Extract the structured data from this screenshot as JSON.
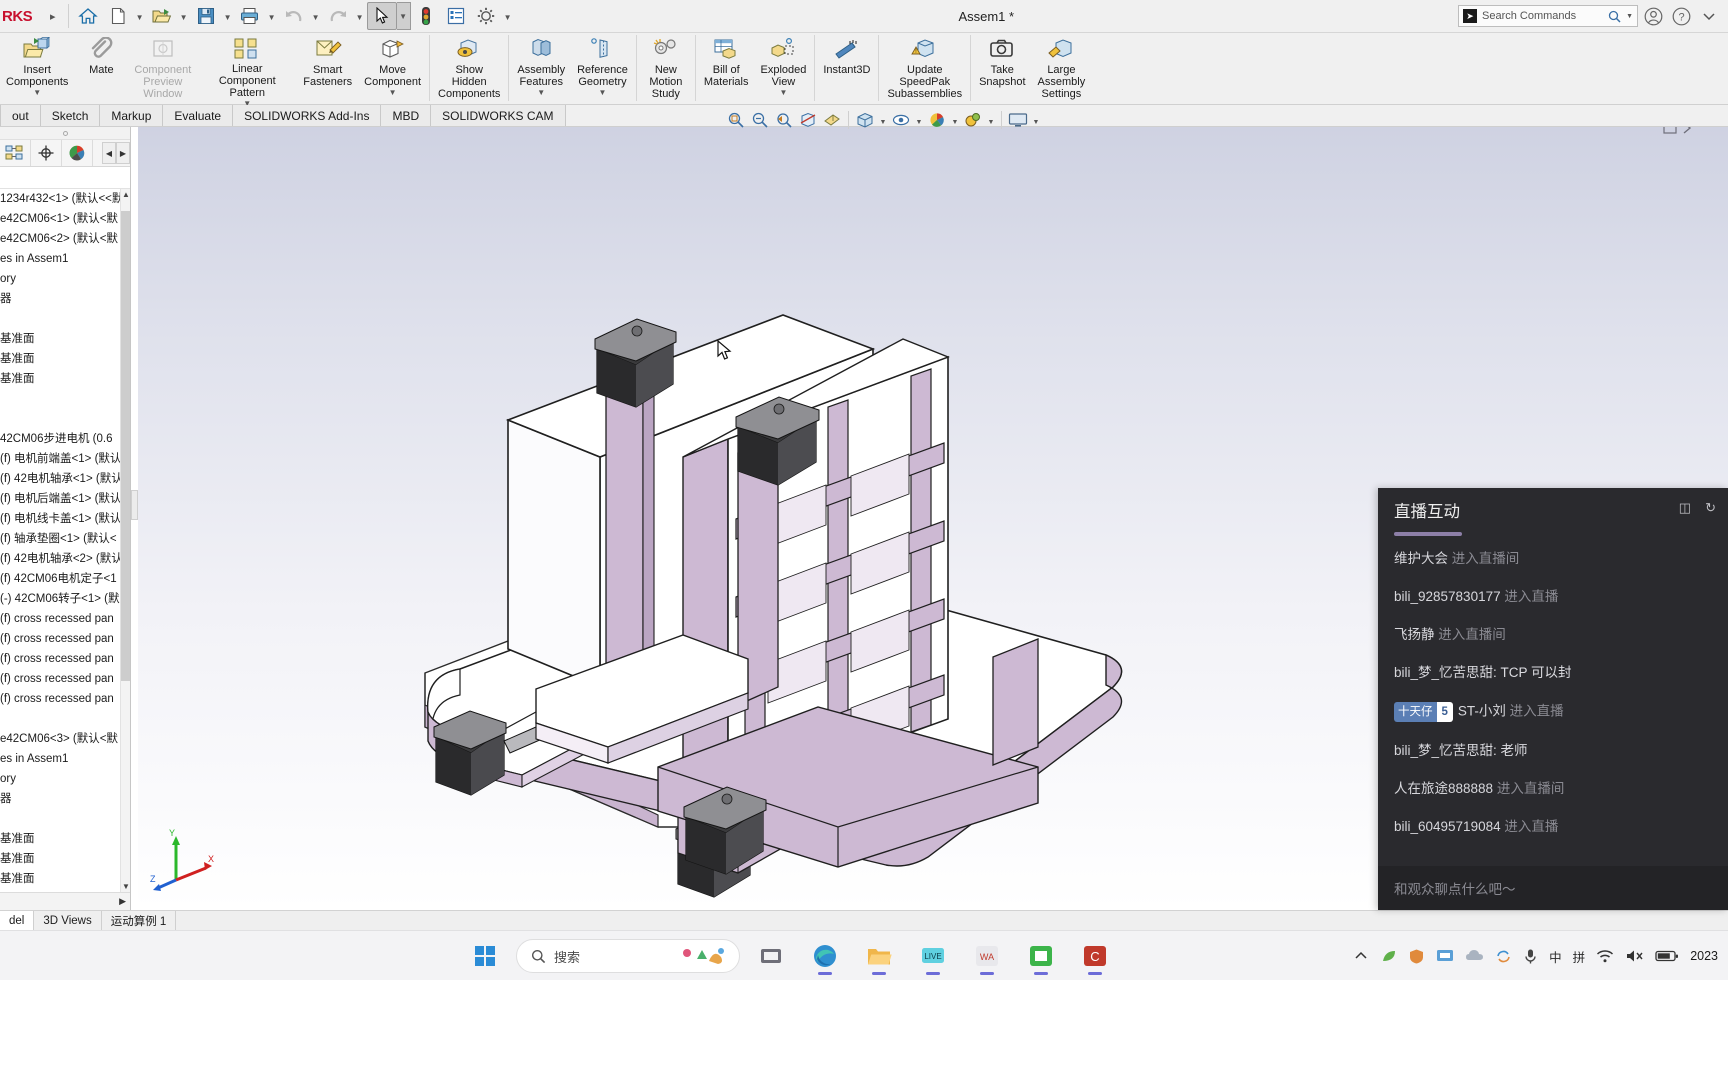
{
  "app": {
    "brand": "RKS",
    "document_title": "Assem1 *",
    "search_placeholder": "Search Commands"
  },
  "quick_access": [
    {
      "name": "home-button",
      "icon": "home-icon"
    },
    {
      "name": "new-document-button",
      "icon": "new-file-icon",
      "dropdown": true
    },
    {
      "name": "open-document-button",
      "icon": "open-folder-icon",
      "dropdown": true
    },
    {
      "name": "save-button",
      "icon": "save-disk-icon",
      "dropdown": true
    },
    {
      "name": "print-button",
      "icon": "printer-icon",
      "dropdown": true
    },
    {
      "name": "undo-button",
      "icon": "undo-arrow-icon",
      "dropdown": true
    },
    {
      "name": "redo-button",
      "icon": "redo-arrow-icon",
      "dropdown": true
    },
    {
      "name": "select-tool-button",
      "icon": "cursor-arrow-icon",
      "dropdown": true,
      "pressed": true
    },
    {
      "name": "rebuild-button",
      "icon": "traffic-light-icon"
    },
    {
      "name": "options-list-button",
      "icon": "list-properties-icon"
    },
    {
      "name": "settings-button",
      "icon": "gear-icon",
      "dropdown": true
    }
  ],
  "ribbon": {
    "items": [
      {
        "label": "Insert\nComponents",
        "lines": [
          "Insert",
          "Components"
        ],
        "icon": "insert-components-icon",
        "caret": true,
        "disabled": false
      },
      {
        "label": "Mate",
        "lines": [
          "Mate"
        ],
        "icon": "mate-paperclip-icon",
        "caret": false,
        "disabled": false
      },
      {
        "label": "Component Preview Window",
        "lines": [
          "Component",
          "Preview",
          "Window"
        ],
        "icon": "component-preview-icon",
        "caret": false,
        "disabled": true
      },
      {
        "label": "Linear Component Pattern",
        "lines": [
          "Linear Component",
          "Pattern"
        ],
        "icon": "linear-pattern-icon",
        "caret": true,
        "disabled": false
      },
      {
        "label": "Smart Fasteners",
        "lines": [
          "Smart",
          "Fasteners"
        ],
        "icon": "smart-fasteners-icon",
        "caret": false,
        "disabled": false
      },
      {
        "label": "Move Component",
        "lines": [
          "Move",
          "Component"
        ],
        "icon": "move-component-icon",
        "caret": true,
        "disabled": false
      },
      {
        "label": "Show Hidden Components",
        "lines": [
          "Show",
          "Hidden",
          "Components"
        ],
        "icon": "show-hidden-components-icon",
        "caret": false,
        "disabled": false
      },
      {
        "label": "Assembly Features",
        "lines": [
          "Assembly",
          "Features"
        ],
        "icon": "assembly-features-icon",
        "caret": true,
        "disabled": false
      },
      {
        "label": "Reference Geometry",
        "lines": [
          "Reference",
          "Geometry"
        ],
        "icon": "reference-geometry-icon",
        "caret": true,
        "disabled": false
      },
      {
        "label": "New Motion Study",
        "lines": [
          "New",
          "Motion",
          "Study"
        ],
        "icon": "new-motion-study-icon",
        "caret": false,
        "disabled": false
      },
      {
        "label": "Bill of Materials",
        "lines": [
          "Bill of",
          "Materials"
        ],
        "icon": "bill-of-materials-icon",
        "caret": false,
        "disabled": false
      },
      {
        "label": "Exploded View",
        "lines": [
          "Exploded",
          "View"
        ],
        "icon": "exploded-view-icon",
        "caret": true,
        "disabled": false
      },
      {
        "label": "Instant3D",
        "lines": [
          "Instant3D"
        ],
        "icon": "instant3d-icon",
        "caret": false,
        "disabled": false
      },
      {
        "label": "Update SpeedPak Subassemblies",
        "lines": [
          "Update",
          "SpeedPak",
          "Subassemblies"
        ],
        "icon": "update-speedpak-icon",
        "caret": false,
        "disabled": false
      },
      {
        "label": "Take Snapshot",
        "lines": [
          "Take",
          "Snapshot"
        ],
        "icon": "camera-icon",
        "caret": false,
        "disabled": false
      },
      {
        "label": "Large Assembly Settings",
        "lines": [
          "Large",
          "Assembly",
          "Settings"
        ],
        "icon": "large-assembly-settings-icon",
        "caret": false,
        "disabled": false
      }
    ]
  },
  "tabs": [
    {
      "label": "out"
    },
    {
      "label": "Sketch"
    },
    {
      "label": "Markup"
    },
    {
      "label": "Evaluate"
    },
    {
      "label": "SOLIDWORKS Add-Ins"
    },
    {
      "label": "MBD"
    },
    {
      "label": "SOLIDWORKS CAM"
    }
  ],
  "view_toolbar": [
    {
      "name": "zoom-to-fit-button",
      "icon": "zoom-fit-icon"
    },
    {
      "name": "zoom-to-area-button",
      "icon": "zoom-area-icon"
    },
    {
      "name": "previous-view-button",
      "icon": "previous-view-icon"
    },
    {
      "name": "section-view-button",
      "icon": "section-view-icon"
    },
    {
      "name": "view-orientation-button",
      "icon": "view-orientation-icon"
    },
    {
      "name": "display-style-button",
      "icon": "display-style-icon",
      "dropdown": true
    },
    {
      "name": "hide-show-items-button",
      "icon": "eye-icon",
      "dropdown": true
    },
    {
      "name": "apply-scene-button",
      "icon": "scene-icon",
      "dropdown": true
    },
    {
      "name": "view-settings-button",
      "icon": "view-settings-icon",
      "dropdown": true
    },
    {
      "name": "viewport-button",
      "icon": "viewport-icon",
      "dropdown": true
    }
  ],
  "feature_tree": {
    "panel_tabs": [
      {
        "name": "feature-manager-tab",
        "icon": "feature-tree-icon"
      },
      {
        "name": "property-manager-tab",
        "icon": "property-target-icon"
      },
      {
        "name": "configuration-manager-tab",
        "icon": "display-manager-sphere-icon"
      }
    ],
    "items": [
      "1234r432<1> (默认<<默",
      "e42CM06<1> (默认<默",
      "e42CM06<2> (默认<默",
      "es in Assem1",
      "ory",
      "器",
      "",
      "基准面",
      "基准面",
      "基准面",
      "",
      "",
      "42CM06步进电机  (0.6",
      "(f) 电机前端盖<1> (默认",
      "(f) 42电机轴承<1> (默认",
      "(f) 电机后端盖<1> (默认",
      "(f) 电机线卡盖<1> (默认",
      "(f) 轴承垫圈<1> (默认<",
      "(f) 42电机轴承<2> (默认",
      "(f) 42CM06电机定子<1",
      "(-) 42CM06转子<1> (默",
      "(f) cross recessed pan",
      "(f) cross recessed pan",
      "(f) cross recessed pan",
      "(f) cross recessed pan",
      "(f) cross recessed pan",
      "",
      "e42CM06<3> (默认<默",
      "es in Assem1",
      "ory",
      "器",
      "",
      "基准面",
      "基准面",
      "基准面"
    ]
  },
  "document_tabs": [
    {
      "label": "del",
      "active": true
    },
    {
      "label": "3D Views",
      "active": false
    },
    {
      "label": "运动算例 1",
      "active": false
    }
  ],
  "chat": {
    "title": "直播互动",
    "header_icons": [
      "expand-icon",
      "refresh-icon"
    ],
    "input_placeholder": "和观众聊点什么吧～",
    "messages": [
      {
        "name": "维护大会",
        "action": "进入直播间",
        "type": "enter"
      },
      {
        "name": "bili_92857830177",
        "action": "进入直播",
        "type": "enter"
      },
      {
        "name": "飞扬静",
        "action": "进入直播间",
        "type": "enter"
      },
      {
        "name": "bili_梦_忆苦思甜",
        "message": ": TCP 可以封",
        "type": "message"
      },
      {
        "name": "ST-小刘",
        "action": "进入直播",
        "type": "enter",
        "badge": {
          "text": "十天仔",
          "level": "5"
        }
      },
      {
        "name": "bili_梦_忆苦思甜",
        "message": ": 老师",
        "type": "message"
      },
      {
        "name": "人在旅途888888",
        "action": "进入直播间",
        "type": "enter"
      },
      {
        "name": "bili_60495719084",
        "action": "进入直播",
        "type": "enter"
      }
    ]
  },
  "taskbar": {
    "search_placeholder": "搜索",
    "apps": [
      {
        "name": "start-button",
        "icon": "windows-logo-icon"
      },
      {
        "name": "taskview-button",
        "icon": "task-view-icon"
      },
      {
        "name": "edge-button",
        "icon": "edge-browser-icon"
      },
      {
        "name": "file-explorer-button",
        "icon": "folder-icon"
      },
      {
        "name": "live-app-button",
        "icon": "live-streaming-icon"
      },
      {
        "name": "wps-button",
        "icon": "wps-office-icon"
      },
      {
        "name": "solidworks-button",
        "icon": "solidworks-icon"
      },
      {
        "name": "capture-button",
        "icon": "capture-app-icon"
      }
    ],
    "tray": [
      {
        "name": "show-hidden-icons",
        "icon": "chevron-up-icon"
      },
      {
        "name": "nvidia-icon",
        "icon": "leaf-icon"
      },
      {
        "name": "security-icon",
        "icon": "shield-icon"
      },
      {
        "name": "meeting-icon",
        "icon": "screen-share-icon"
      },
      {
        "name": "onedrive-icon",
        "icon": "cloud-icon"
      },
      {
        "name": "sync-icon",
        "icon": "sync-arrows-icon"
      },
      {
        "name": "microphone-icon",
        "icon": "mic-icon"
      },
      {
        "name": "ime-mode",
        "label": "中"
      },
      {
        "name": "ime-pinyin",
        "label": "拼"
      },
      {
        "name": "network-icon",
        "icon": "wifi-icon"
      },
      {
        "name": "volume-icon",
        "icon": "speaker-mute-icon"
      },
      {
        "name": "battery-icon",
        "icon": "battery-icon"
      }
    ],
    "clock_year": "2023"
  }
}
